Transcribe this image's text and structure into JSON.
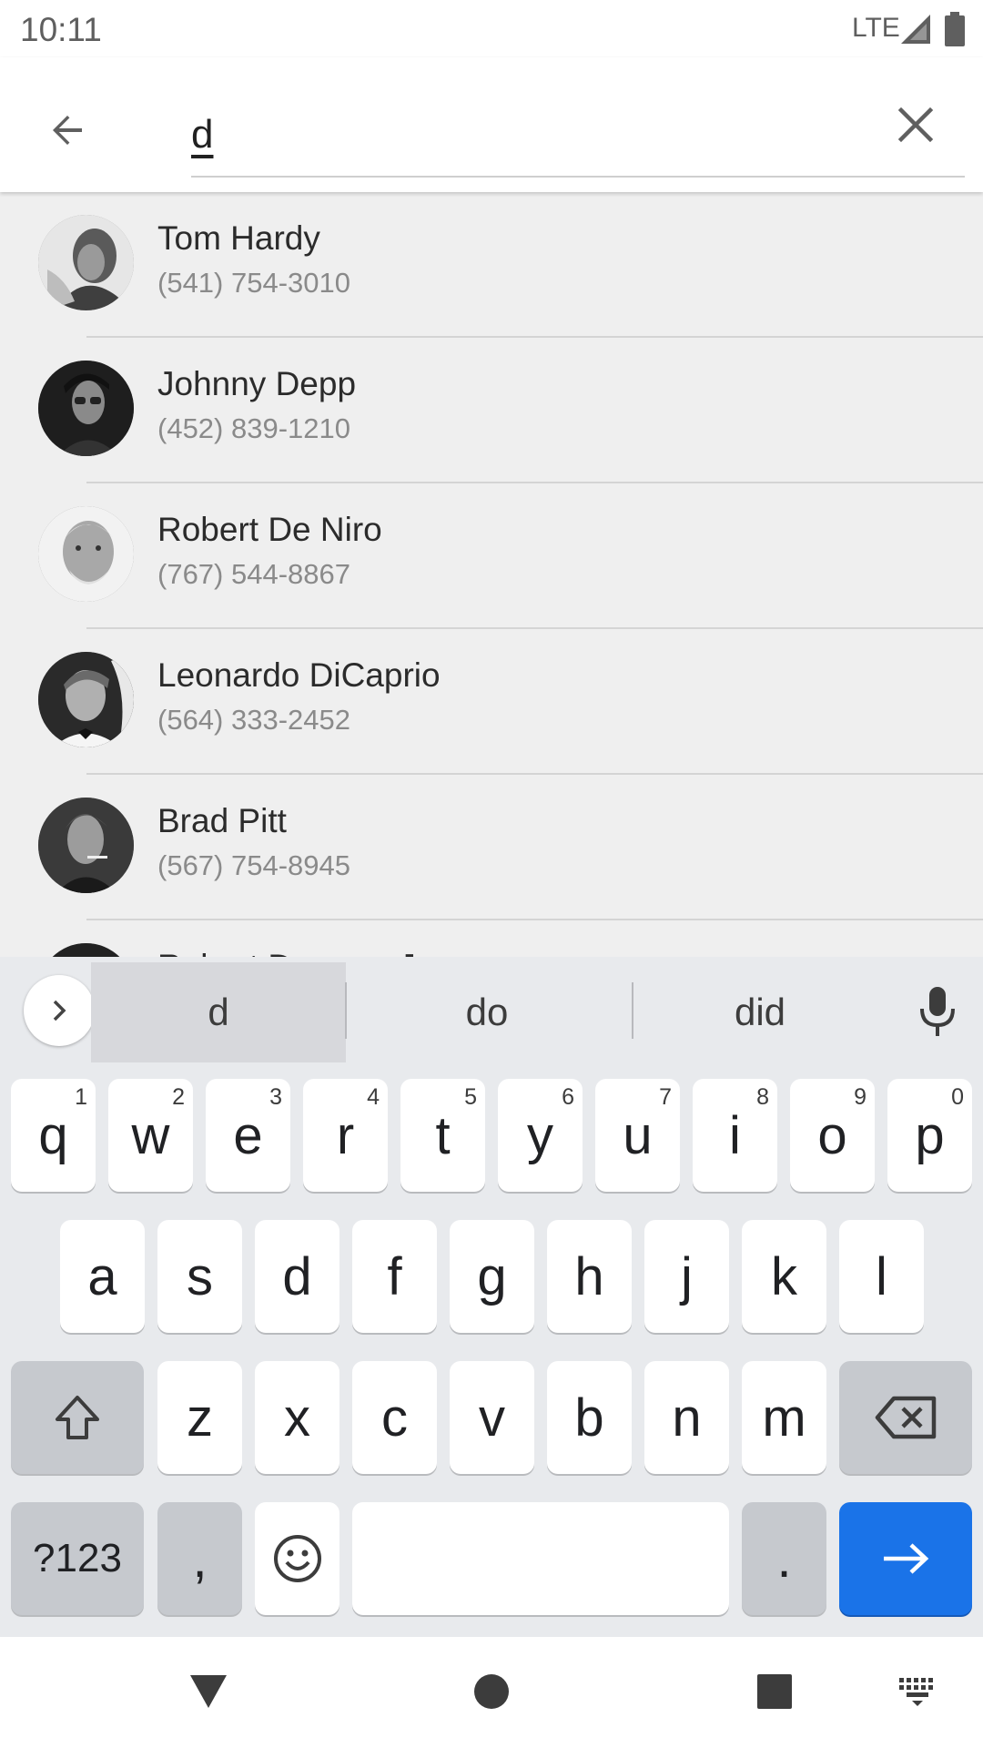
{
  "status_bar": {
    "time": "10:11",
    "network": "LTE",
    "signal_icon": "signal-icon",
    "battery_icon": "battery-icon"
  },
  "search": {
    "back_icon": "arrow-back-icon",
    "query": "d",
    "clear_icon": "close-icon"
  },
  "contacts": [
    {
      "name": "Tom Hardy",
      "phone": "(541) 754-3010",
      "avatar": "avatar-tom-hardy"
    },
    {
      "name": "Johnny Depp",
      "phone": "(452) 839-1210",
      "avatar": "avatar-johnny-depp"
    },
    {
      "name": "Robert De Niro",
      "phone": "(767) 544-8867",
      "avatar": "avatar-robert-de-niro"
    },
    {
      "name": "Leonardo DiCaprio",
      "phone": "(564) 333-2452",
      "avatar": "avatar-leonardo-dicaprio"
    },
    {
      "name": "Brad Pitt",
      "phone": "(567) 754-8945",
      "avatar": "avatar-brad-pitt"
    },
    {
      "name": "Robert Downey Jr.",
      "phone": "",
      "avatar": "avatar-partially-visible"
    }
  ],
  "keyboard": {
    "suggestions": [
      "d",
      "do",
      "did"
    ],
    "selected_suggestion": "d",
    "row1": [
      {
        "key": "q",
        "hint": "1"
      },
      {
        "key": "w",
        "hint": "2"
      },
      {
        "key": "e",
        "hint": "3"
      },
      {
        "key": "r",
        "hint": "4"
      },
      {
        "key": "t",
        "hint": "5"
      },
      {
        "key": "y",
        "hint": "6"
      },
      {
        "key": "u",
        "hint": "7"
      },
      {
        "key": "i",
        "hint": "8"
      },
      {
        "key": "o",
        "hint": "9"
      },
      {
        "key": "p",
        "hint": "0"
      }
    ],
    "row2": [
      "a",
      "s",
      "d",
      "f",
      "g",
      "h",
      "j",
      "k",
      "l"
    ],
    "row3": [
      "z",
      "x",
      "c",
      "v",
      "b",
      "n",
      "m"
    ],
    "symbols_label": "?123",
    "comma_label": ",",
    "period_label": ".",
    "emoji_icon": "emoji-icon",
    "shift_icon": "shift-icon",
    "backspace_icon": "backspace-icon",
    "enter_icon": "arrow-forward-icon",
    "mic_icon": "mic-icon",
    "expand_icon": "chevron-right-icon",
    "enter_color": "#1a73e8"
  },
  "nav_bar": {
    "back_icon": "nav-back-triangle-icon",
    "home_icon": "nav-home-circle-icon",
    "recents_icon": "nav-recents-square-icon",
    "keyboard_icon": "keyboard-switch-icon"
  }
}
